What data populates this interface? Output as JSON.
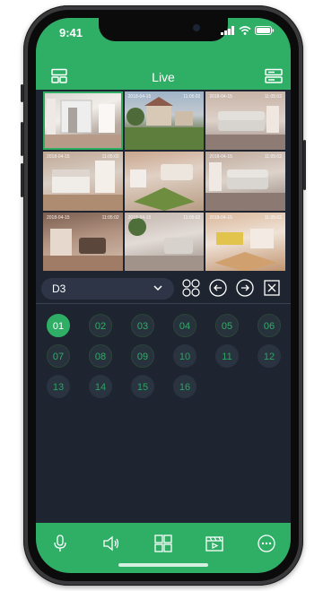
{
  "status_bar": {
    "time": "9:41"
  },
  "header": {
    "title": "Live"
  },
  "camera_grid": {
    "tiles": [
      {
        "date": "",
        "time": "",
        "selected": true
      },
      {
        "date": "2018-04-15",
        "time": "11:05:02",
        "selected": false
      },
      {
        "date": "2018-04-15",
        "time": "11:05:02",
        "selected": false
      },
      {
        "date": "2018-04-15",
        "time": "11:05:02",
        "selected": false
      },
      {
        "date": "",
        "time": "",
        "selected": false
      },
      {
        "date": "2018-04-15",
        "time": "11:05:02",
        "selected": false
      },
      {
        "date": "2018-04-15",
        "time": "11:05:02",
        "selected": false
      },
      {
        "date": "2018-04-15",
        "time": "11:05:02",
        "selected": false
      },
      {
        "date": "2018-04-15",
        "time": "11:05:02",
        "selected": false
      }
    ]
  },
  "controls": {
    "device_select": "D3"
  },
  "channels": [
    {
      "label": "01",
      "state": "active"
    },
    {
      "label": "02",
      "state": "online"
    },
    {
      "label": "03",
      "state": "online"
    },
    {
      "label": "04",
      "state": "online"
    },
    {
      "label": "05",
      "state": "online"
    },
    {
      "label": "06",
      "state": "online"
    },
    {
      "label": "07",
      "state": "online"
    },
    {
      "label": "08",
      "state": "online"
    },
    {
      "label": "09",
      "state": "online"
    },
    {
      "label": "10",
      "state": "offline"
    },
    {
      "label": "11",
      "state": "offline"
    },
    {
      "label": "12",
      "state": "offline"
    },
    {
      "label": "13",
      "state": "offline"
    },
    {
      "label": "14",
      "state": "offline"
    },
    {
      "label": "15",
      "state": "offline"
    },
    {
      "label": "16",
      "state": "offline"
    }
  ],
  "bottom_bar": {
    "items": [
      "microphone-icon",
      "speaker-icon",
      "layout-grid-icon",
      "playback-icon",
      "more-icon"
    ]
  },
  "colors": {
    "accent": "#2fae66",
    "panel": "#1f2530",
    "select_bg": "#2d3547"
  }
}
